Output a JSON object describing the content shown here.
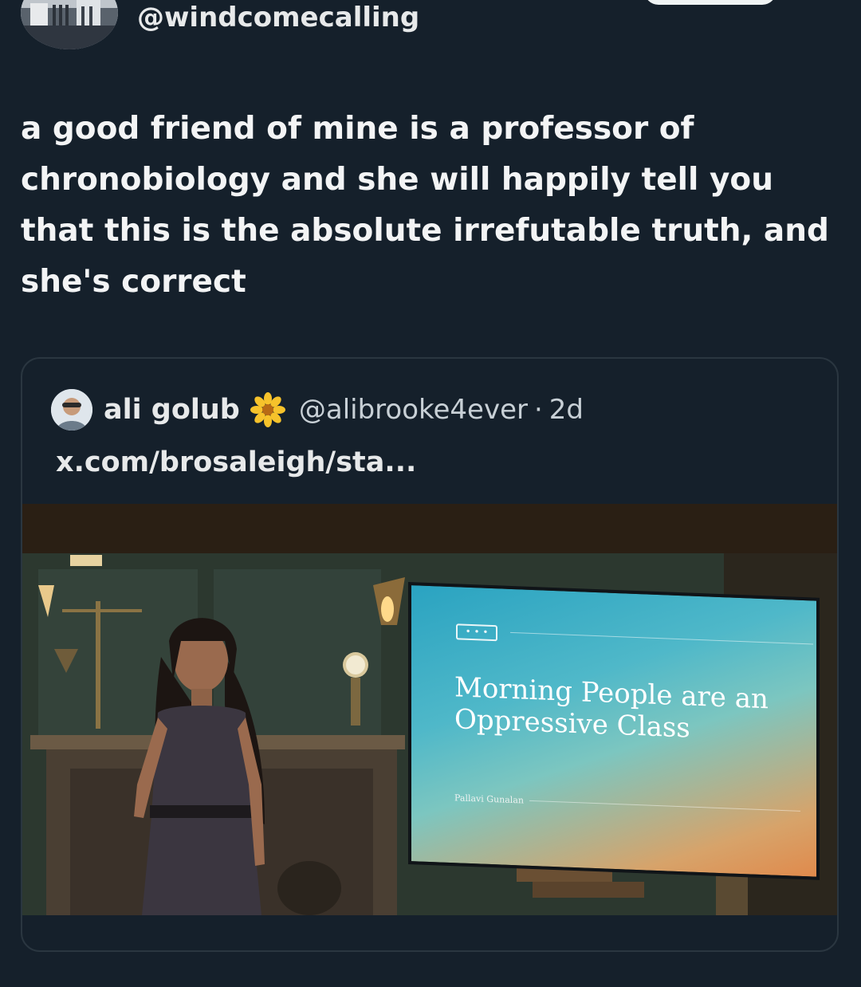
{
  "header": {
    "handle": "@windcomecalling"
  },
  "tweet": {
    "text": "a good friend of mine is a professor of chronobiology and she will happily tell you that this is the absolute irrefutable truth, and she's correct"
  },
  "quote": {
    "name": "ali golub",
    "emoji": "flower-icon",
    "username": "@alibrooke4ever",
    "separator": "·",
    "time": "2d",
    "link": "x.com/brosaleigh/sta..."
  },
  "media": {
    "slide_title": "Morning People are an Oppressive Class",
    "slide_author": "Pallavi Gunalan"
  },
  "colors": {
    "background": "#15202b",
    "text": "#e7e9ea",
    "secondary_text": "#c8d0d6",
    "card_border": "#2a3640"
  }
}
